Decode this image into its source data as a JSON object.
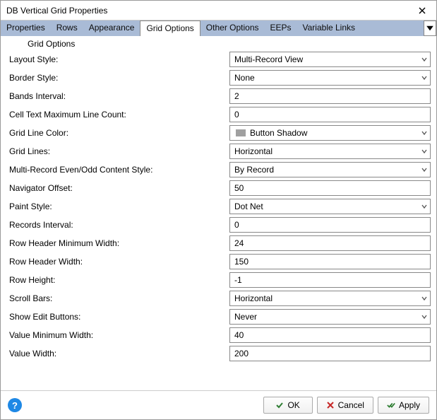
{
  "window": {
    "title": "DB Vertical Grid Properties"
  },
  "tabs": {
    "items": [
      {
        "label": "Properties"
      },
      {
        "label": "Rows"
      },
      {
        "label": "Appearance"
      },
      {
        "label": "Grid Options"
      },
      {
        "label": "Other Options"
      },
      {
        "label": "EEPs"
      },
      {
        "label": "Variable Links"
      }
    ],
    "active_index": 3
  },
  "section": {
    "header": "Grid Options"
  },
  "props": [
    {
      "label": "Layout Style:",
      "value": "Multi-Record View",
      "type": "dropdown"
    },
    {
      "label": "Border Style:",
      "value": "None",
      "type": "dropdown"
    },
    {
      "label": "Bands Interval:",
      "value": "2",
      "type": "number"
    },
    {
      "label": "Cell Text Maximum Line Count:",
      "value": "0",
      "type": "number"
    },
    {
      "label": "Grid Line Color:",
      "value": "Button Shadow",
      "type": "color",
      "swatch": "#a0a0a0"
    },
    {
      "label": "Grid Lines:",
      "value": "Horizontal",
      "type": "dropdown"
    },
    {
      "label": "Multi-Record Even/Odd Content Style:",
      "value": "By Record",
      "type": "dropdown"
    },
    {
      "label": "Navigator Offset:",
      "value": "50",
      "type": "number"
    },
    {
      "label": "Paint Style:",
      "value": "Dot Net",
      "type": "dropdown"
    },
    {
      "label": "Records Interval:",
      "value": "0",
      "type": "number"
    },
    {
      "label": "Row Header Minimum Width:",
      "value": "24",
      "type": "number"
    },
    {
      "label": "Row Header Width:",
      "value": "150",
      "type": "number"
    },
    {
      "label": "Row Height:",
      "value": "-1",
      "type": "number"
    },
    {
      "label": "Scroll Bars:",
      "value": "Horizontal",
      "type": "dropdown"
    },
    {
      "label": "Show Edit Buttons:",
      "value": "Never",
      "type": "dropdown"
    },
    {
      "label": "Value Minimum Width:",
      "value": "40",
      "type": "number"
    },
    {
      "label": "Value Width:",
      "value": "200",
      "type": "number"
    }
  ],
  "footer": {
    "ok": "OK",
    "cancel": "Cancel",
    "apply": "Apply"
  }
}
